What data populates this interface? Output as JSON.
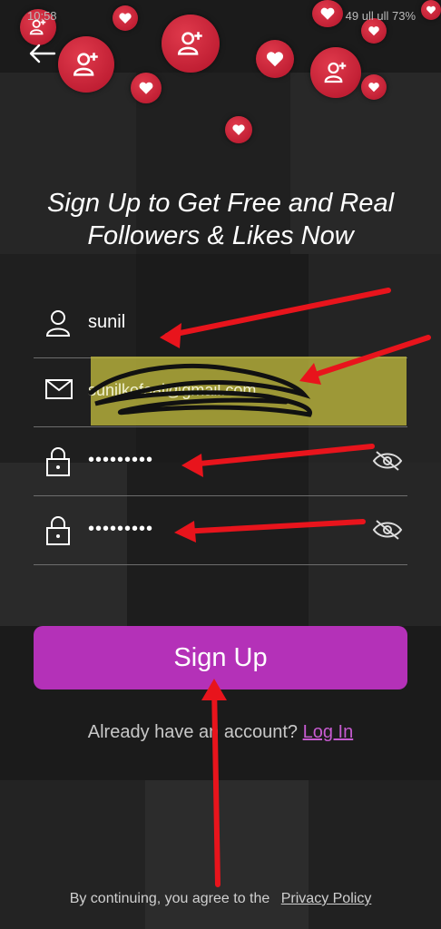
{
  "status_bar": {
    "time": "10:58",
    "right": "49 ull ull 73%"
  },
  "headline": {
    "line1": "Sign Up to Get Free and Real",
    "line2": "Followers & Likes Now"
  },
  "form": {
    "username": "sunil",
    "email": "sunilkofoal@gmail.com",
    "password_mask": "•••••••••",
    "confirm_mask": "•••••••••"
  },
  "signup_button": "Sign Up",
  "login": {
    "prompt": "Already have an account?",
    "link": "Log In"
  },
  "footer": {
    "text": "By continuing, you agree to the",
    "link": "Privacy Policy"
  },
  "colors": {
    "accent": "#b431b8",
    "bubble": "#c81e32",
    "annotation": "#e8141c"
  },
  "icons": [
    "back-arrow-icon",
    "user-icon",
    "mail-icon",
    "lock-icon",
    "eye-off-icon",
    "heart-icon",
    "add-user-icon"
  ]
}
